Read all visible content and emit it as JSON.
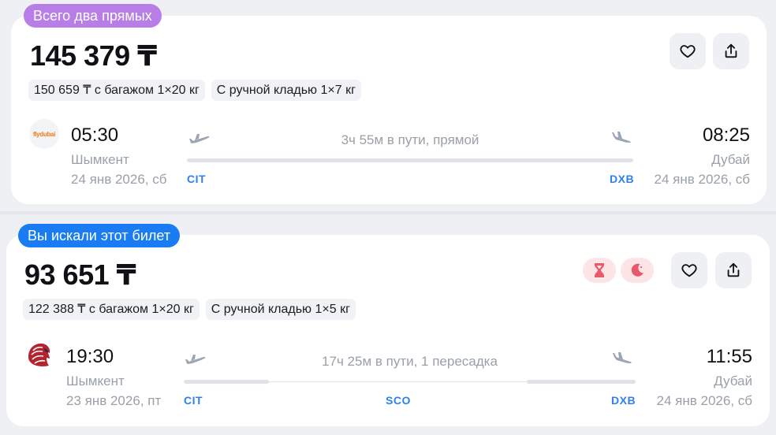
{
  "tickets": [
    {
      "badge": "Всего два прямых",
      "price": "145 379 ₸",
      "baggage_chip": "150 659 ₸ с багажом 1×20 кг",
      "hand_chip": "С ручной кладью 1×7 кг",
      "airline_logo_text": "flydubai",
      "depart_time": "05:30",
      "depart_city": "Шымкент",
      "depart_date": "24 янв 2026, сб",
      "arrive_time": "08:25",
      "arrive_city": "Дубай",
      "arrive_date": "24 янв 2026, сб",
      "duration": "3ч 55м в пути, прямой",
      "origin_code": "CIT",
      "dest_code": "DXB"
    },
    {
      "badge": "Вы искали этот билет",
      "price": "93 651 ₸",
      "baggage_chip": "122 388 ₸ с багажом 1×20 кг",
      "hand_chip": "С ручной кладью 1×5 кг",
      "depart_time": "19:30",
      "depart_city": "Шымкент",
      "depart_date": "23 янв 2026, пт",
      "arrive_time": "11:55",
      "arrive_city": "Дубай",
      "arrive_date": "24 янв 2026, сб",
      "duration": "17ч 25м в пути, 1 пересадка",
      "origin_code": "CIT",
      "stop_code": "SCO",
      "dest_code": "DXB",
      "tag_icons": [
        "hourglass-icon",
        "moon-icon"
      ]
    }
  ],
  "colors": {
    "badge_purple": "#b77ee8",
    "badge_blue": "#1a7cf2",
    "iata_blue": "#2f80ed",
    "tag_pink_bg": "#fde4e7",
    "tag_pink_fg": "#e85a6b"
  }
}
